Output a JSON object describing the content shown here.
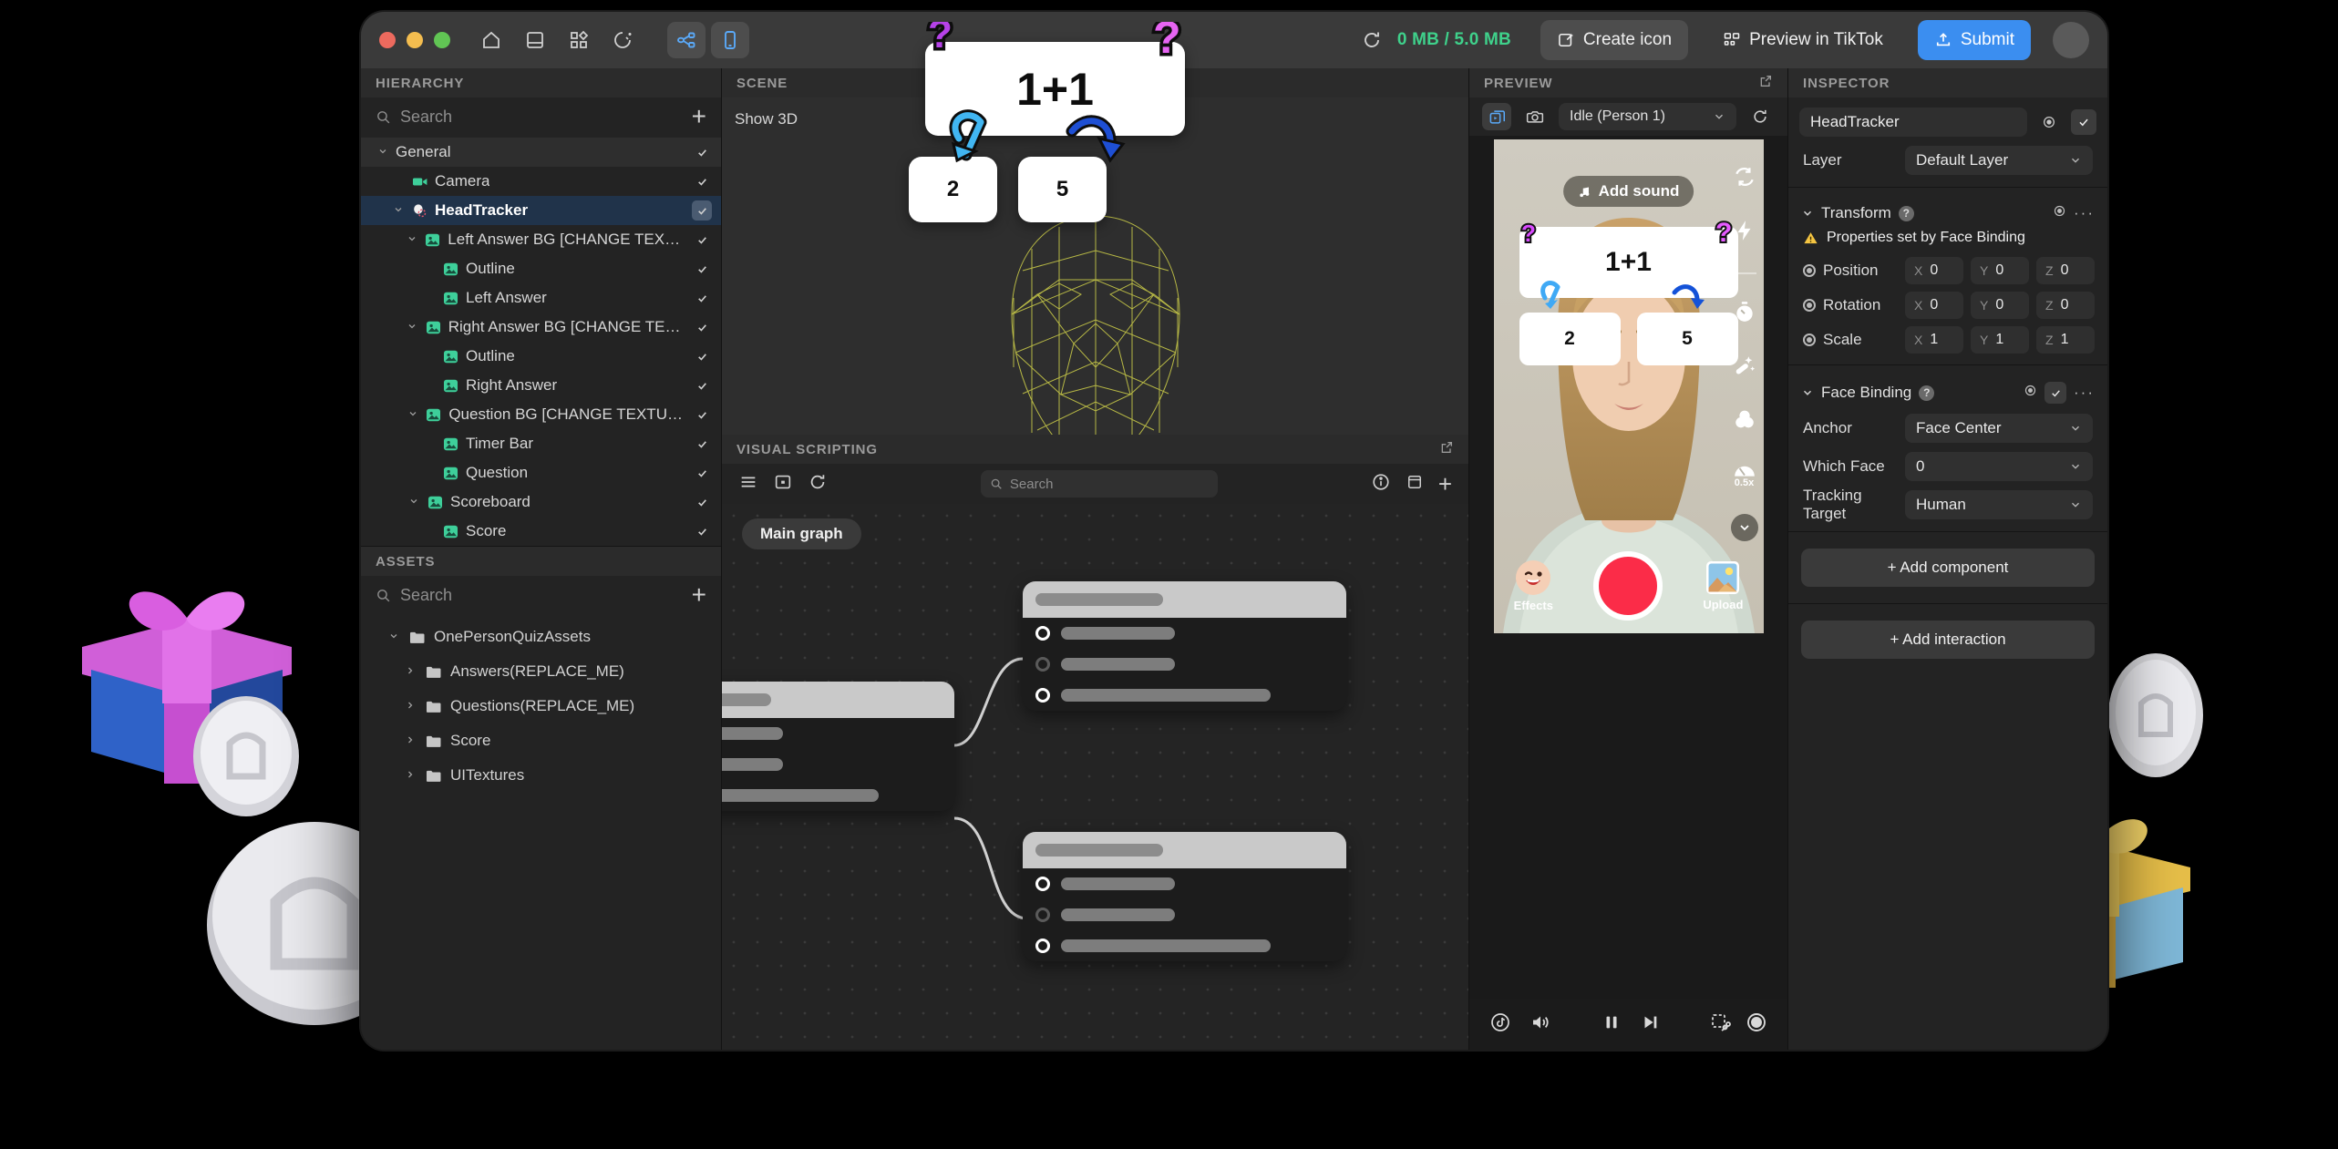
{
  "titlebar": {
    "window_buttons": [
      "close",
      "minimize",
      "maximize"
    ],
    "icons": [
      "home-icon",
      "book-icon",
      "grid-icon",
      "magic-icon",
      "node-graph-icon",
      "phone-icon"
    ],
    "memory": "0 MB / 5.0 MB",
    "refresh_icon": "refresh-icon",
    "create_icon_label": "Create icon",
    "preview_tiktok_label": "Preview in TikTok",
    "submit_label": "Submit",
    "accent_blue": "#3b8ef0",
    "memory_green": "#3fd18b"
  },
  "hierarchy": {
    "title": "HIERARCHY",
    "search_placeholder": "Search",
    "add_label": "+",
    "items": [
      {
        "label": "General",
        "depth": 0,
        "type": "group",
        "caret": "down",
        "checked": true,
        "icon": ""
      },
      {
        "label": "Camera",
        "depth": 1,
        "type": "node",
        "caret": "",
        "checked": true,
        "icon": "camera-icon"
      },
      {
        "label": "HeadTracker",
        "depth": 1,
        "type": "node",
        "caret": "down",
        "checked": true,
        "icon": "head-tracker-icon",
        "selected": true
      },
      {
        "label": "Left Answer BG [CHANGE TEXTU...",
        "depth": 2,
        "type": "node",
        "caret": "down",
        "checked": true,
        "icon": "image-icon"
      },
      {
        "label": "Outline",
        "depth": 3,
        "type": "node",
        "caret": "",
        "checked": true,
        "icon": "image-icon"
      },
      {
        "label": "Left Answer",
        "depth": 3,
        "type": "node",
        "caret": "",
        "checked": true,
        "icon": "image-icon"
      },
      {
        "label": "Right Answer BG [CHANGE TEXT...",
        "depth": 2,
        "type": "node",
        "caret": "down",
        "checked": true,
        "icon": "image-icon"
      },
      {
        "label": "Outline",
        "depth": 3,
        "type": "node",
        "caret": "",
        "checked": true,
        "icon": "image-icon"
      },
      {
        "label": "Right Answer",
        "depth": 3,
        "type": "node",
        "caret": "",
        "checked": true,
        "icon": "image-icon"
      },
      {
        "label": "Question BG [CHANGE TEXTURE]",
        "depth": 2,
        "type": "node",
        "caret": "down",
        "checked": true,
        "icon": "image-icon"
      },
      {
        "label": "Timer Bar",
        "depth": 3,
        "type": "node",
        "caret": "",
        "checked": true,
        "icon": "image-icon"
      },
      {
        "label": "Question",
        "depth": 3,
        "type": "node",
        "caret": "",
        "checked": true,
        "icon": "image-icon"
      },
      {
        "label": "Scoreboard",
        "depth": 2,
        "type": "node",
        "caret": "down",
        "checked": true,
        "icon": "image-icon"
      },
      {
        "label": "Score",
        "depth": 3,
        "type": "node",
        "caret": "",
        "checked": true,
        "icon": "image-icon"
      }
    ]
  },
  "assets": {
    "title": "ASSETS",
    "search_placeholder": "Search",
    "items": [
      {
        "label": "OnePersonQuizAssets",
        "depth": 0,
        "caret": "down"
      },
      {
        "label": "Answers(REPLACE_ME)",
        "depth": 1,
        "caret": "right"
      },
      {
        "label": "Questions(REPLACE_ME)",
        "depth": 1,
        "caret": "right"
      },
      {
        "label": "Score",
        "depth": 1,
        "caret": "right"
      },
      {
        "label": "UITextures",
        "depth": 1,
        "caret": "right"
      }
    ]
  },
  "scene": {
    "title": "SCENE",
    "show_3d_label": "Show 3D",
    "quiz": {
      "question": "1+1",
      "left_answer": "2",
      "right_answer": "5"
    }
  },
  "visual_scripting": {
    "title": "VISUAL SCRIPTING",
    "search_placeholder": "Search",
    "graph_tab": "Main graph",
    "toolbar_icons": [
      "menu-icon",
      "frame-icon",
      "refresh-icon",
      "info-icon",
      "panel-icon",
      "add-icon"
    ],
    "expand_icon": "expand-icon"
  },
  "preview": {
    "title": "PREVIEW",
    "expand_icon": "expand-icon",
    "mode_icons": [
      "video-preview-icon",
      "camera-icon"
    ],
    "source": "Idle (Person 1)",
    "refresh_icon": "refresh-icon",
    "add_sound_label": "Add sound",
    "side_tools": [
      "flip-camera-icon",
      "flash-icon",
      "timer-icon",
      "beautify-icon",
      "filters-icon",
      "speed-icon",
      "chevron-down-icon"
    ],
    "speed_label": "0.5x",
    "effects_label": "Effects",
    "upload_label": "Upload",
    "quiz": {
      "question": "1+1",
      "left_answer": "2",
      "right_answer": "5"
    },
    "playbar_icons": [
      "tiktok-icon",
      "volume-icon",
      "pause-icon",
      "step-forward-icon",
      "crop-icon",
      "record-icon"
    ]
  },
  "inspector": {
    "title": "INSPECTOR",
    "object_name": "HeadTracker",
    "layer_label": "Layer",
    "layer_value": "Default Layer",
    "transform": {
      "section_label": "Transform",
      "warning": "Properties set by Face Binding",
      "rows": [
        {
          "label": "Position",
          "x": "0",
          "y": "0",
          "z": "0"
        },
        {
          "label": "Rotation",
          "x": "0",
          "y": "0",
          "z": "0"
        },
        {
          "label": "Scale",
          "x": "1",
          "y": "1",
          "z": "1"
        }
      ],
      "axes": [
        "X",
        "Y",
        "Z"
      ]
    },
    "face_binding": {
      "section_label": "Face Binding",
      "rows": [
        {
          "label": "Anchor",
          "value": "Face Center"
        },
        {
          "label": "Which Face",
          "value": "0"
        },
        {
          "label": "Tracking Target",
          "value": "Human"
        }
      ]
    },
    "add_component_label": "+ Add component",
    "add_interaction_label": "+ Add interaction"
  }
}
